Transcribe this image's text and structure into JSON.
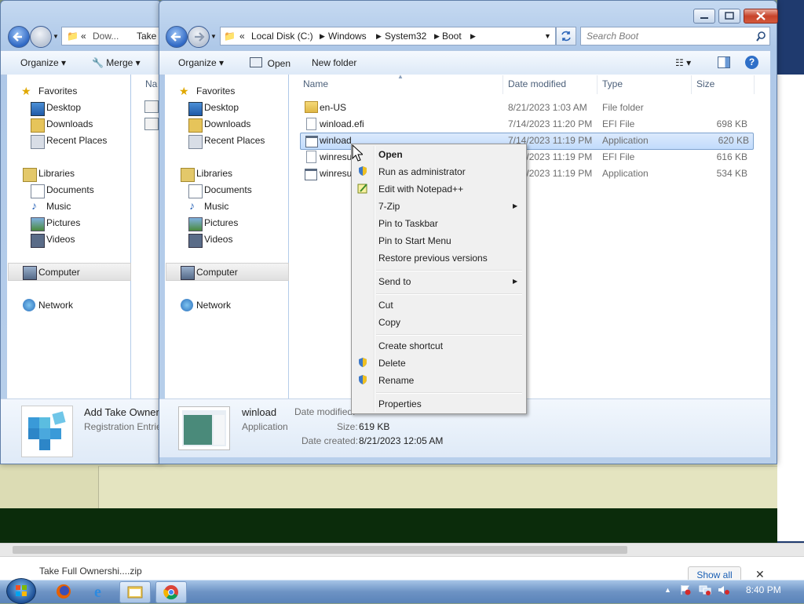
{
  "back_window": {
    "breadcrumb": [
      "«",
      "Dow...",
      "Take"
    ],
    "toolbar": {
      "organize": "Organize",
      "merge": "Merge"
    },
    "column_name": "Na",
    "details": {
      "name": "Add Take Owner",
      "type": "Registration Entrie"
    }
  },
  "front_window": {
    "breadcrumb": [
      "«",
      "Local Disk (C:)",
      "Windows",
      "System32",
      "Boot"
    ],
    "search_placeholder": "Search Boot",
    "toolbar": {
      "organize": "Organize",
      "open": "Open",
      "new_folder": "New folder"
    },
    "nav": {
      "favorites": "Favorites",
      "favorites_items": [
        "Desktop",
        "Downloads",
        "Recent Places"
      ],
      "libraries": "Libraries",
      "libraries_items": [
        "Documents",
        "Music",
        "Pictures",
        "Videos"
      ],
      "computer": "Computer",
      "network": "Network"
    },
    "columns": {
      "name": "Name",
      "date": "Date modified",
      "type": "Type",
      "size": "Size"
    },
    "files": [
      {
        "name": "en-US",
        "date": "8/21/2023 1:03 AM",
        "type": "File folder",
        "size": ""
      },
      {
        "name": "winload.efi",
        "date": "7/14/2023 11:20 PM",
        "type": "EFI File",
        "size": "698 KB"
      },
      {
        "name": "winload",
        "date": "7/14/2023 11:19 PM",
        "type": "Application",
        "size": "620 KB"
      },
      {
        "name": "winresu",
        "date": "7/14/2023 11:19 PM",
        "type": "EFI File",
        "size": "616 KB"
      },
      {
        "name": "winresu",
        "date": "7/14/2023 11:19 PM",
        "type": "Application",
        "size": "534 KB"
      }
    ],
    "details": {
      "name": "winload",
      "type": "Application",
      "date_modified_label": "Date modified:",
      "size_label": "Size:",
      "size": "619 KB",
      "date_created_label": "Date created:",
      "date_created": "8/21/2023 12:05 AM"
    }
  },
  "context_menu": {
    "open": "Open",
    "run_as_admin": "Run as administrator",
    "edit_notepad": "Edit with Notepad++",
    "zip": "7-Zip",
    "pin_taskbar": "Pin to Taskbar",
    "pin_start": "Pin to Start Menu",
    "restore": "Restore previous versions",
    "send_to": "Send to",
    "cut": "Cut",
    "copy": "Copy",
    "create_shortcut": "Create shortcut",
    "delete": "Delete",
    "rename": "Rename",
    "properties": "Properties"
  },
  "download_bar": {
    "item": "Take Full Ownershi....zip",
    "show_all": "Show all"
  },
  "taskbar": {
    "clock": "8:40 PM"
  },
  "colors": {
    "accent": "#2f68c4",
    "selection": "#c1dbfc",
    "close": "#c7432b"
  }
}
